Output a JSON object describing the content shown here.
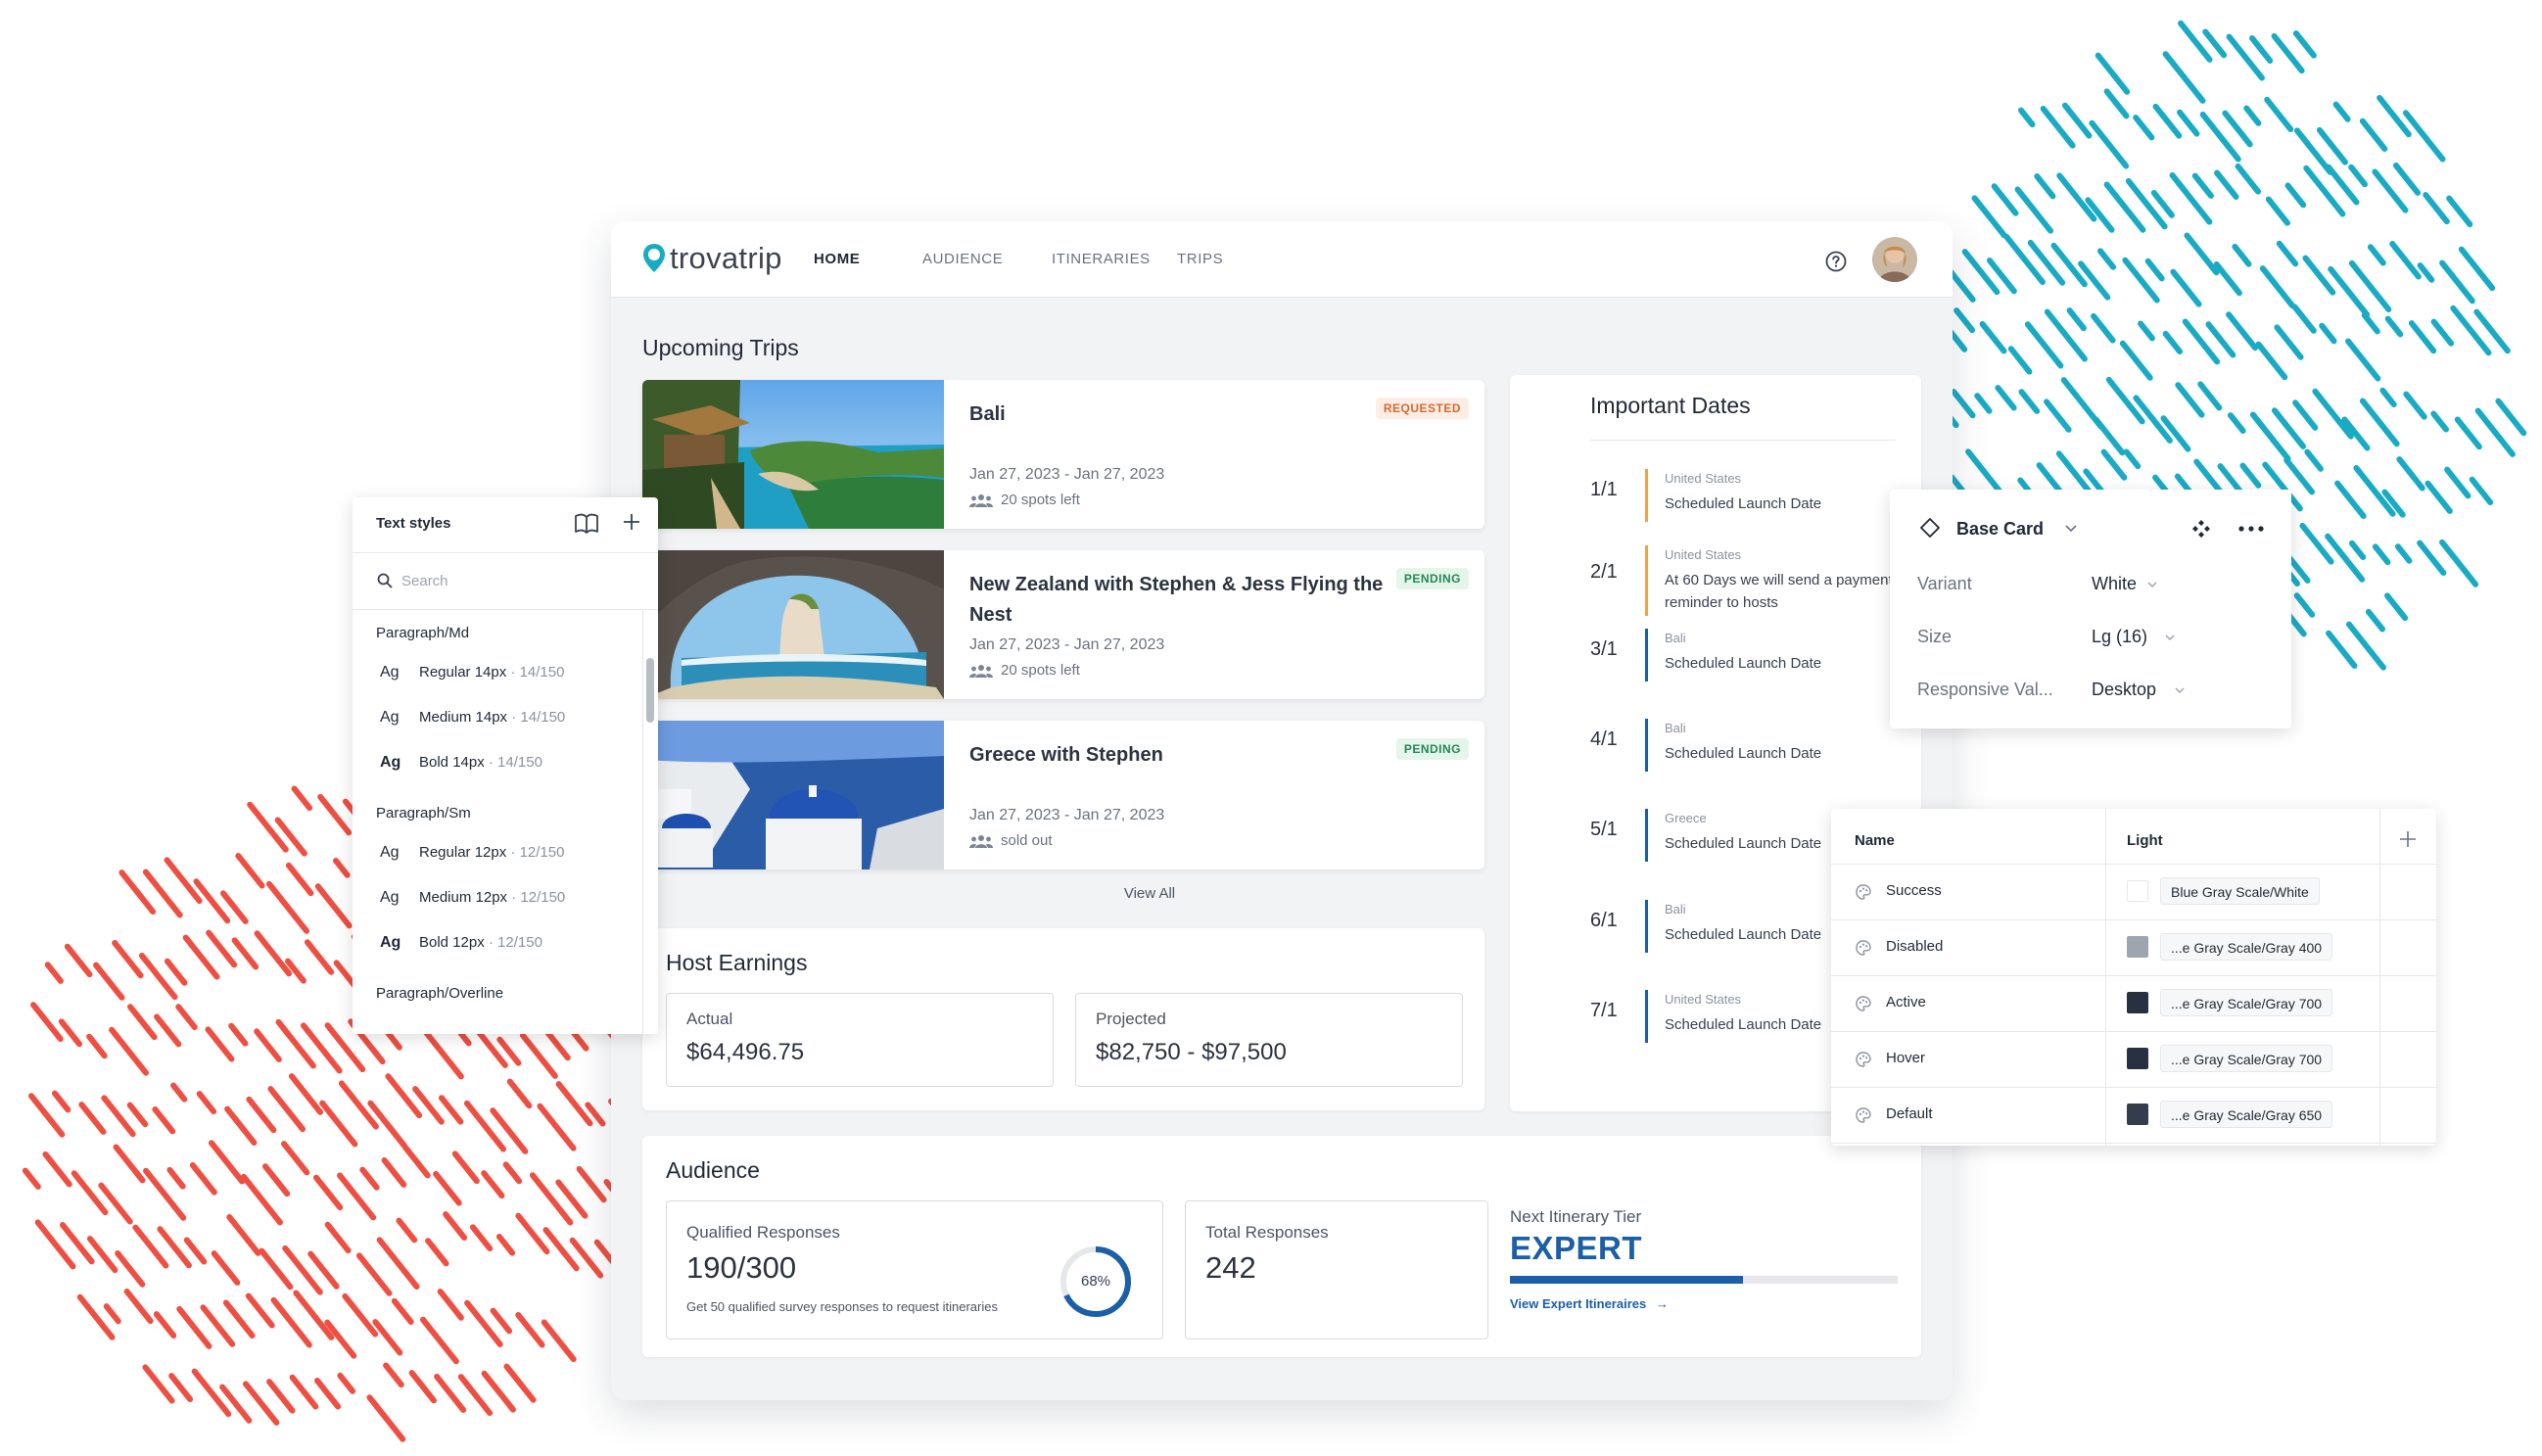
{
  "colors": {
    "teal_decoration": "#1aabc4",
    "red_decoration": "#ee4f42",
    "brand_blue": "#1a5fa8",
    "requested_text": "#d8682f",
    "pending_text": "#27865a",
    "date_bar_orange": "#f0a24b",
    "date_bar_blue": "#1a5fa8"
  },
  "app": {
    "logo_text": "trovatrip",
    "nav": [
      "HOME",
      "AUDIENCE",
      "ITINERARIES",
      "TRIPS"
    ],
    "active_nav": "HOME",
    "help_icon": "help-circle-icon",
    "upcoming_title": "Upcoming Trips",
    "trips": [
      {
        "name": "Bali",
        "dates": "Jan 27, 2023 - Jan 27, 2023",
        "spots": "20 spots left",
        "status": "REQUESTED"
      },
      {
        "name": "New Zealand with Stephen & Jess Flying the Nest",
        "dates": "Jan 27, 2023 - Jan 27, 2023",
        "spots": "20 spots left",
        "status": "PENDING"
      },
      {
        "name": "Greece with Stephen",
        "dates": "Jan 27, 2023 - Jan 27, 2023",
        "spots": "sold out",
        "status": "PENDING"
      }
    ],
    "view_all": "View All",
    "earnings": {
      "title": "Host Earnings",
      "actual_label": "Actual",
      "actual_value": "$64,496.75",
      "projected_label": "Projected",
      "projected_value": "$82,750 - $97,500"
    },
    "important_dates": {
      "title": "Important Dates",
      "rows": [
        {
          "date": "1/1",
          "country": "United States",
          "desc": "Scheduled Launch Date",
          "bar": "orange"
        },
        {
          "date": "2/1",
          "country": "United States",
          "desc": "At 60 Days we will send a payment reminder to hosts",
          "bar": "orange"
        },
        {
          "date": "3/1",
          "country": "Bali",
          "desc": "Scheduled Launch Date",
          "bar": "blue"
        },
        {
          "date": "4/1",
          "country": "Bali",
          "desc": "Scheduled Launch Date",
          "bar": "blue"
        },
        {
          "date": "5/1",
          "country": "Greece",
          "desc": "Scheduled Launch Date",
          "bar": "blue"
        },
        {
          "date": "6/1",
          "country": "Bali",
          "desc": "Scheduled Launch Date",
          "bar": "blue"
        },
        {
          "date": "7/1",
          "country": "United States",
          "desc": "Scheduled Launch Date",
          "bar": "blue"
        }
      ]
    },
    "audience": {
      "title": "Audience",
      "qualified_label": "Qualified Responses",
      "qualified_value": "190/300",
      "qualified_note": "Get 50 qualified survey responses to request itineraries",
      "qualified_percent": 68,
      "qualified_percent_text": "68%",
      "total_label": "Total Responses",
      "total_value": "242",
      "tier_label": "Next Itinerary Tier",
      "tier_value": "EXPERT",
      "tier_progress": 0.6,
      "tier_link": "View Expert Itineraires"
    }
  },
  "text_styles": {
    "title": "Text styles",
    "search_placeholder": "Search",
    "groups": [
      {
        "name": "Paragraph/Md",
        "items": [
          {
            "ag": "Ag",
            "label": "Regular 14px",
            "meta": "· 14/150",
            "weight": "normal"
          },
          {
            "ag": "Ag",
            "label": "Medium 14px",
            "meta": "· 14/150",
            "weight": "medium"
          },
          {
            "ag": "Ag",
            "label": "Bold 14px",
            "meta": "· 14/150",
            "weight": "bold"
          }
        ]
      },
      {
        "name": "Paragraph/Sm",
        "items": [
          {
            "ag": "Ag",
            "label": "Regular 12px",
            "meta": "· 12/150",
            "weight": "normal"
          },
          {
            "ag": "Ag",
            "label": "Medium 12px",
            "meta": "· 12/150",
            "weight": "medium"
          },
          {
            "ag": "Ag",
            "label": "Bold 12px",
            "meta": "· 12/150",
            "weight": "bold"
          }
        ]
      },
      {
        "name": "Paragraph/Overline",
        "items": []
      }
    ]
  },
  "base_card": {
    "title": "Base Card",
    "props": [
      {
        "label": "Variant",
        "value": "White"
      },
      {
        "label": "Size",
        "value": "Lg (16)"
      },
      {
        "label": "Responsive Val...",
        "value": "Desktop"
      }
    ]
  },
  "tokens": {
    "col_name": "Name",
    "col_light": "Light",
    "rows": [
      {
        "name": "Success",
        "value": "Blue Gray Scale/White",
        "swatch": "#ffffff"
      },
      {
        "name": "Disabled",
        "value": "...e Gray Scale/Gray 400",
        "swatch": "#9ea5b0"
      },
      {
        "name": "Active",
        "value": "...e Gray Scale/Gray 700",
        "swatch": "#283142"
      },
      {
        "name": "Hover",
        "value": "...e Gray Scale/Gray 700",
        "swatch": "#283142"
      },
      {
        "name": "Default",
        "value": "...e Gray Scale/Gray 650",
        "swatch": "#343d4d"
      }
    ]
  }
}
